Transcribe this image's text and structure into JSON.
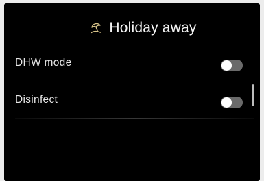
{
  "header": {
    "icon": "beach-umbrella-icon",
    "title": "Holiday away",
    "icon_color": "#d8c48a"
  },
  "settings": [
    {
      "label": "DHW mode",
      "toggle_on": false
    },
    {
      "label": "Disinfect",
      "toggle_on": false
    }
  ],
  "colors": {
    "background": "#000000",
    "text": "#f4f4f4",
    "toggle_off": "#6a6a6a",
    "knob": "#ffffff"
  }
}
